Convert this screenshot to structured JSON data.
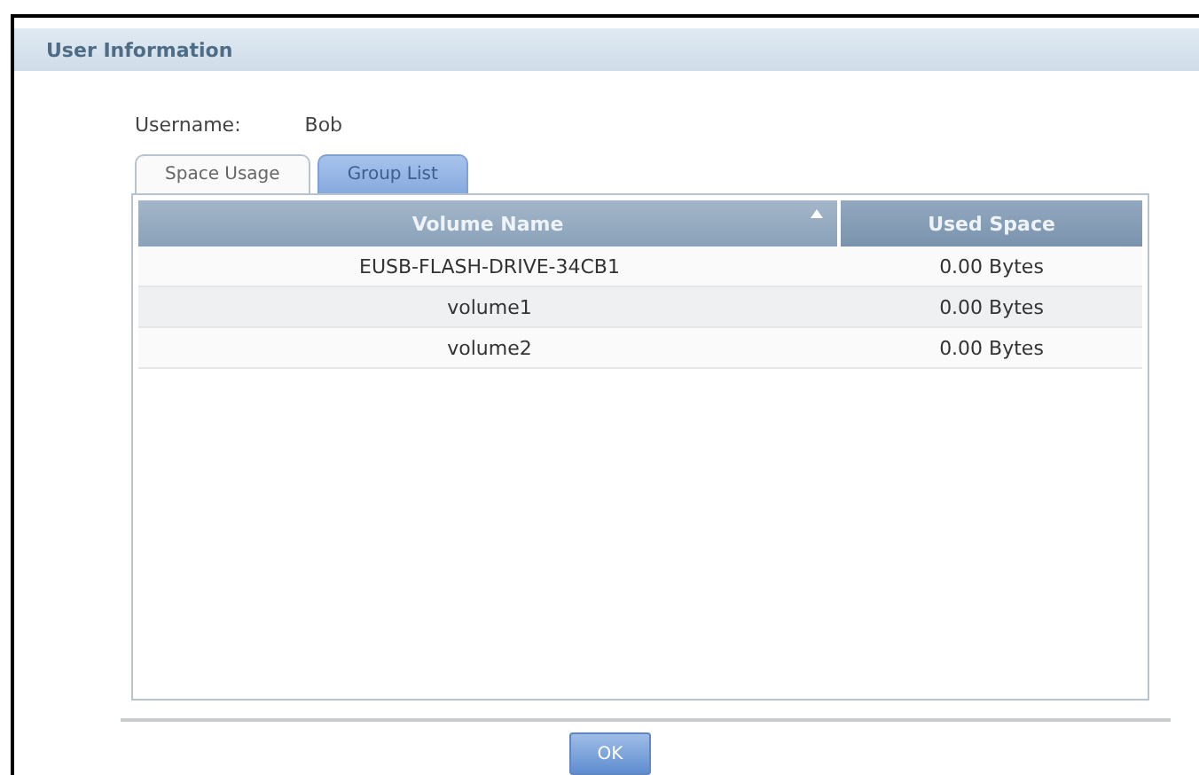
{
  "panel": {
    "title": "User Information"
  },
  "username": {
    "label": "Username:",
    "value": "Bob"
  },
  "tabs": [
    {
      "label": "Space Usage",
      "selected": true
    },
    {
      "label": "Group List",
      "selected": false
    }
  ],
  "table": {
    "columns": [
      {
        "label": "Volume Name",
        "sorted": true
      },
      {
        "label": "Used Space",
        "sorted": false
      }
    ],
    "rows": [
      [
        "EUSB-FLASH-DRIVE-34CB1",
        "0.00 Bytes"
      ],
      [
        "volume1",
        "0.00 Bytes"
      ],
      [
        "volume2",
        "0.00 Bytes"
      ]
    ]
  },
  "buttons": [
    "OK"
  ]
}
